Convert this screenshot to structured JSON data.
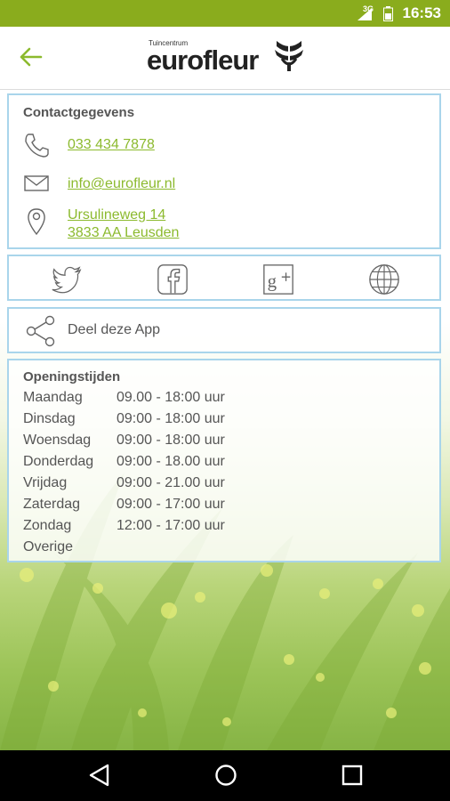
{
  "status_bar": {
    "network": "3G",
    "time": "16:53",
    "bar_color": "#8aac1d"
  },
  "app_bar": {
    "back_icon": "arrow-left-icon",
    "logo_small": "Tuincentrum",
    "logo_word": "eurofleur",
    "logo_icon": "eurofleur-flower-icon"
  },
  "contact": {
    "title": "Contactgegevens",
    "phone": "033 434 7878",
    "email": "info@eurofleur.nl",
    "address_line1": "Ursulineweg 14 ",
    "address_line2": "3833 AA Leusden"
  },
  "social": {
    "items": [
      {
        "icon": "twitter-icon"
      },
      {
        "icon": "facebook-icon"
      },
      {
        "icon": "google-plus-icon"
      },
      {
        "icon": "globe-icon"
      }
    ]
  },
  "share": {
    "label": "Deel deze App",
    "icon": "share-icon"
  },
  "hours": {
    "title": "Openingstijden",
    "rows": [
      {
        "day": "Maandag",
        "time": "09.00 - 18:00 uur"
      },
      {
        "day": "Dinsdag",
        "time": "09:00 - 18:00 uur"
      },
      {
        "day": "Woensdag",
        "time": "09:00 - 18:00 uur"
      },
      {
        "day": "Donderdag",
        "time": "09:00 - 18.00 uur"
      },
      {
        "day": "Vrijdag",
        "time": "09:00 - 21.00 uur"
      },
      {
        "day": "Zaterdag",
        "time": "09:00 - 17:00 uur"
      },
      {
        "day": "Zondag",
        "time": "12:00 - 17:00 uur"
      },
      {
        "day": "Overige",
        "time": ""
      }
    ]
  },
  "colors": {
    "accent_green": "#8cba2e",
    "card_border": "#a9d5eb"
  },
  "nav_bar": {
    "back": "nav-back-icon",
    "home": "nav-home-icon",
    "recents": "nav-recents-icon"
  }
}
